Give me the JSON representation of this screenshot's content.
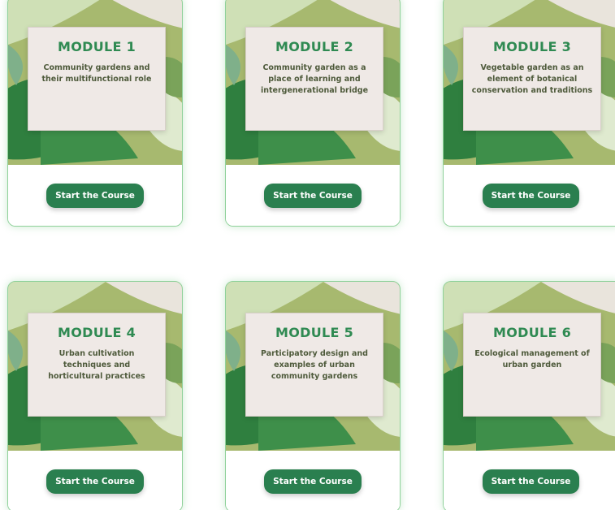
{
  "modules": [
    {
      "title": "MODULE 1",
      "description": "Community gardens and their multifunctional role",
      "button_label": "Start the Course"
    },
    {
      "title": "MODULE 2",
      "description": "Community garden as a place of learning and intergenerational bridge",
      "button_label": "Start the Course"
    },
    {
      "title": "MODULE 3",
      "description": "Vegetable garden as an element of botanical conservation and traditions",
      "button_label": "Start the Course"
    },
    {
      "title": "MODULE 4",
      "description": "Urban cultivation techniques and horticultural practices",
      "button_label": "Start the Course"
    },
    {
      "title": "MODULE 5",
      "description": "Participatory design and examples of urban community gardens",
      "button_label": "Start the Course"
    },
    {
      "title": "MODULE 6",
      "description": "Ecological management of urban garden",
      "button_label": "Start the Course"
    }
  ],
  "colors": {
    "accent": "#2f8a52",
    "button": "#2a7f4f",
    "panel": "#efe9e6",
    "card_border": "#8fd19a"
  }
}
